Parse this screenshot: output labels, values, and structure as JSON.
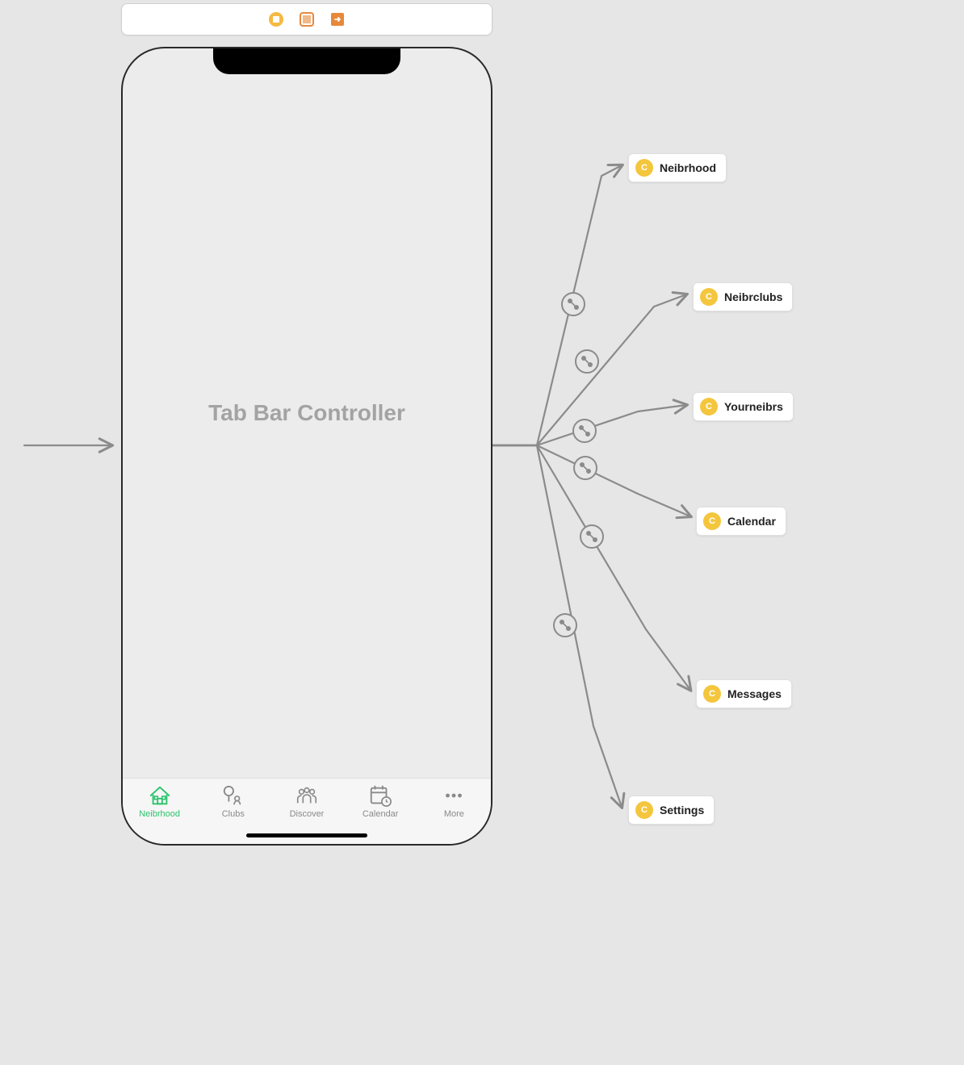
{
  "phone": {
    "title": "Tab Bar Controller",
    "tabs": [
      {
        "label": "Neibrhood",
        "active": true
      },
      {
        "label": "Clubs",
        "active": false
      },
      {
        "label": "Discover",
        "active": false
      },
      {
        "label": "Calendar",
        "active": false
      },
      {
        "label": "More",
        "active": false
      }
    ]
  },
  "destinations": [
    {
      "label": "Neibrhood"
    },
    {
      "label": "Neibrclubs"
    },
    {
      "label": "Yourneibrs"
    },
    {
      "label": "Calendar"
    },
    {
      "label": "Messages"
    },
    {
      "label": "Settings"
    }
  ],
  "colors": {
    "active_tab": "#2cc36b",
    "inactive_tab": "#8a8a8a",
    "connector": "#8b8b8b",
    "chip_icon": "#f4c63d"
  }
}
